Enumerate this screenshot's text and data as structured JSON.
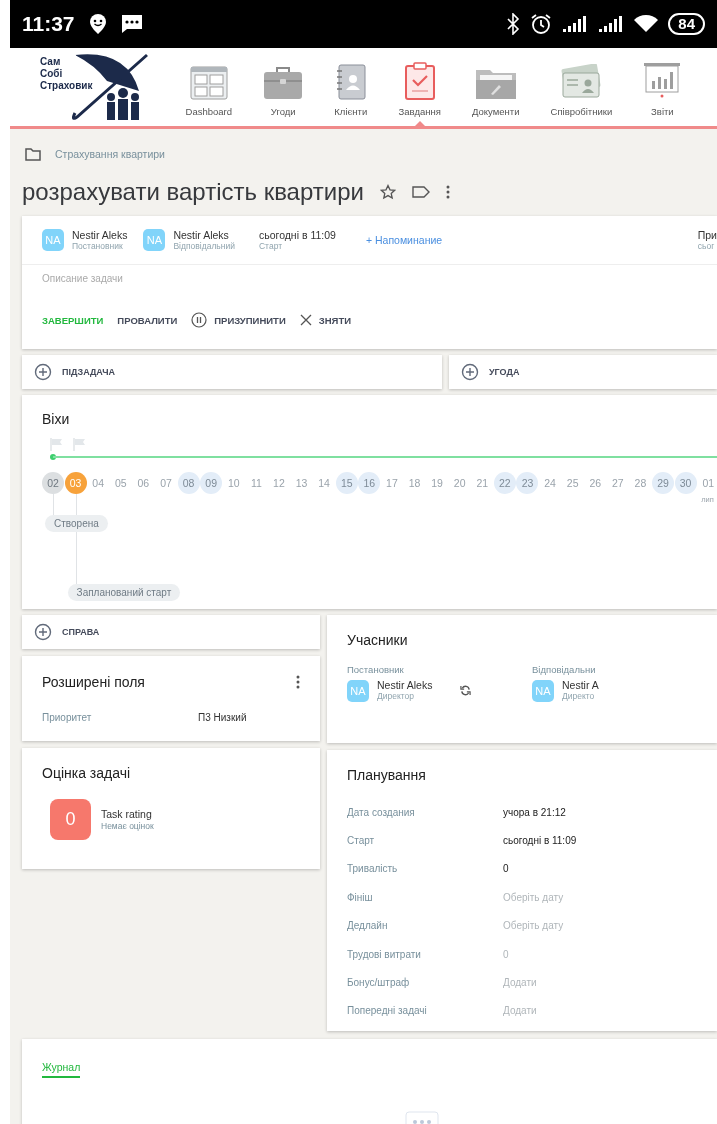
{
  "status_bar": {
    "time": "11:37",
    "battery": "84"
  },
  "logo": {
    "lines": [
      "Сам",
      "Собі",
      "Страховик"
    ]
  },
  "nav": [
    {
      "label": "Dashboard",
      "selected": false
    },
    {
      "label": "Угоди",
      "selected": false
    },
    {
      "label": "Клієнти",
      "selected": false
    },
    {
      "label": "Завдання",
      "selected": true
    },
    {
      "label": "Документи",
      "selected": false
    },
    {
      "label": "Співробітники",
      "selected": false
    },
    {
      "label": "Звіти",
      "selected": false
    }
  ],
  "breadcrumb": "Страхування квартири",
  "title": "розрахувати вартість квартири",
  "header_card": {
    "people": [
      {
        "initials": "NA",
        "name": "Nestir Aleks",
        "role": "Постановник"
      },
      {
        "initials": "NA",
        "name": "Nestir Aleks",
        "role": "Відповідальний"
      }
    ],
    "start": {
      "value": "сьогодні в 11:09",
      "label": "Старт"
    },
    "reminder": "+ Напоминание",
    "column_5": {
      "value": "При",
      "label": "сьог"
    },
    "description_placeholder": "Описание задачи",
    "actions": [
      {
        "label": "ЗАВЕРШИТИ",
        "kind": "primary"
      },
      {
        "label": "ПРОВАЛИТИ",
        "kind": "plain"
      },
      {
        "label": "ПРИЗУПИНИТИ",
        "kind": "pause"
      },
      {
        "label": "ЗНЯТИ",
        "kind": "cancel"
      }
    ]
  },
  "links": [
    {
      "label": "ПІДЗАДАЧА"
    },
    {
      "label": "УГОДА"
    }
  ],
  "milestones": {
    "title": "Віхи",
    "days": [
      {
        "day": "02",
        "kind": "past",
        "flag": true
      },
      {
        "day": "03",
        "kind": "today",
        "flag": true
      },
      {
        "day": "04",
        "kind": "normal"
      },
      {
        "day": "05",
        "kind": "normal"
      },
      {
        "day": "06",
        "kind": "normal"
      },
      {
        "day": "07",
        "kind": "normal"
      },
      {
        "day": "08",
        "kind": "weekend"
      },
      {
        "day": "09",
        "kind": "weekend"
      },
      {
        "day": "10",
        "kind": "normal"
      },
      {
        "day": "11",
        "kind": "normal"
      },
      {
        "day": "12",
        "kind": "normal"
      },
      {
        "day": "13",
        "kind": "normal"
      },
      {
        "day": "14",
        "kind": "normal"
      },
      {
        "day": "15",
        "kind": "weekend"
      },
      {
        "day": "16",
        "kind": "weekend"
      },
      {
        "day": "17",
        "kind": "normal"
      },
      {
        "day": "18",
        "kind": "normal"
      },
      {
        "day": "19",
        "kind": "normal"
      },
      {
        "day": "20",
        "kind": "normal"
      },
      {
        "day": "21",
        "kind": "normal"
      },
      {
        "day": "22",
        "kind": "weekend"
      },
      {
        "day": "23",
        "kind": "weekend"
      },
      {
        "day": "24",
        "kind": "normal"
      },
      {
        "day": "25",
        "kind": "normal"
      },
      {
        "day": "26",
        "kind": "normal"
      },
      {
        "day": "27",
        "kind": "normal"
      },
      {
        "day": "28",
        "kind": "normal"
      },
      {
        "day": "29",
        "kind": "weekend"
      },
      {
        "day": "30",
        "kind": "weekend"
      },
      {
        "day": "01",
        "kind": "normal",
        "month": "лип"
      }
    ],
    "events": [
      "Створена",
      "Запланований старт"
    ]
  },
  "case_link": {
    "label": "СПРАВА"
  },
  "extended_fields": {
    "title": "Розширені поля",
    "fields": [
      {
        "label": "Приоритет",
        "value": "П3 Низкий"
      }
    ]
  },
  "rating": {
    "title": "Оцінка задачі",
    "score": "0",
    "name": "Task rating",
    "note": "Немає оцінок"
  },
  "participants": {
    "title": "Учасники",
    "groups": [
      {
        "role": "Постановник",
        "initials": "NA",
        "name": "Nestir Aleks",
        "position": "Директор"
      },
      {
        "role": "Відповідальни",
        "initials": "NA",
        "name": "Nestir A",
        "position": "Директо"
      }
    ]
  },
  "planning": {
    "title": "Планування",
    "rows": [
      {
        "label": "Дата создания",
        "value": "учора в 21:12"
      },
      {
        "label": "Старт",
        "value": "сьогодні в 11:09"
      },
      {
        "label": "Тривалість",
        "value": "0"
      },
      {
        "label": "Фініш",
        "placeholder": "Оберіть дату"
      },
      {
        "label": "Дедлайн",
        "placeholder": "Оберіть дату"
      },
      {
        "label": "Трудові витрати",
        "placeholder": "0"
      },
      {
        "label": "Бонус/штраф",
        "placeholder": "Додати"
      },
      {
        "label": "Попередні задачі",
        "placeholder": "Додати"
      }
    ]
  },
  "journal": {
    "tabs": [
      {
        "label": "Журнал",
        "selected": true
      }
    ]
  }
}
